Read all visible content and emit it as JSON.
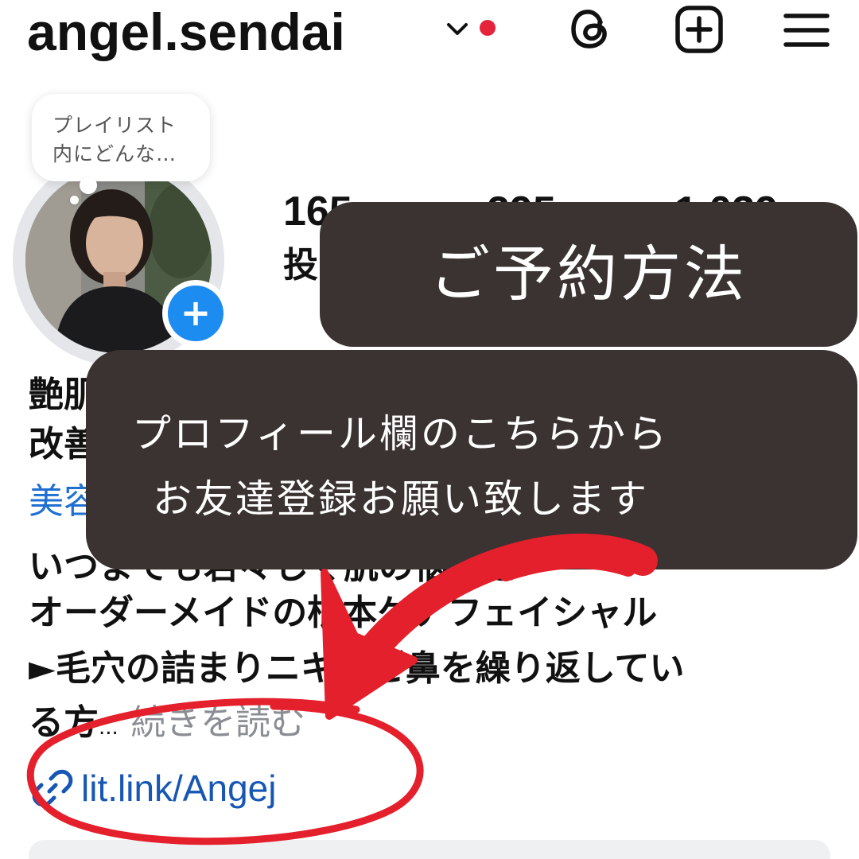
{
  "header": {
    "username": "angel.sendai",
    "icons": [
      "chevron-down-icon",
      "notification-dot",
      "threads-icon",
      "plus-square-icon",
      "menu-icon"
    ],
    "notification_dot_color": "#e5243b"
  },
  "note": {
    "text": "プレイリスト\n内にどんな…"
  },
  "profile": {
    "add_story_symbol": "+",
    "stats": [
      {
        "value": "165",
        "label": "投"
      },
      {
        "value": "295",
        "label": ""
      },
      {
        "value": "1,039",
        "label": ""
      }
    ]
  },
  "bio": {
    "line1": "艶肌",
    "line2": "改善",
    "category": "美容",
    "line4": "いつまでも若々しく肌の悩みを",
    "line5": "オーダーメイドの根本ケアフェイシャル",
    "line6": "►毛穴の詰まりニキビご鼻を繰り返してい",
    "line7_prefix": "る方",
    "ellipsis": "...",
    "more": "続きを読む",
    "link": "lit.link/Angej"
  },
  "overlay": {
    "title": "ご予約方法",
    "line1": "プロフィール欄のこちらから",
    "line2": "お友達登録お願い致します",
    "banner_color": "#3b3232"
  },
  "annotation": {
    "color": "#e3202b",
    "shapes": [
      "arrow",
      "circle"
    ]
  },
  "colors": {
    "link": "#1757b3",
    "category": "#1f6fd1",
    "accent": "#1c8cf0"
  }
}
